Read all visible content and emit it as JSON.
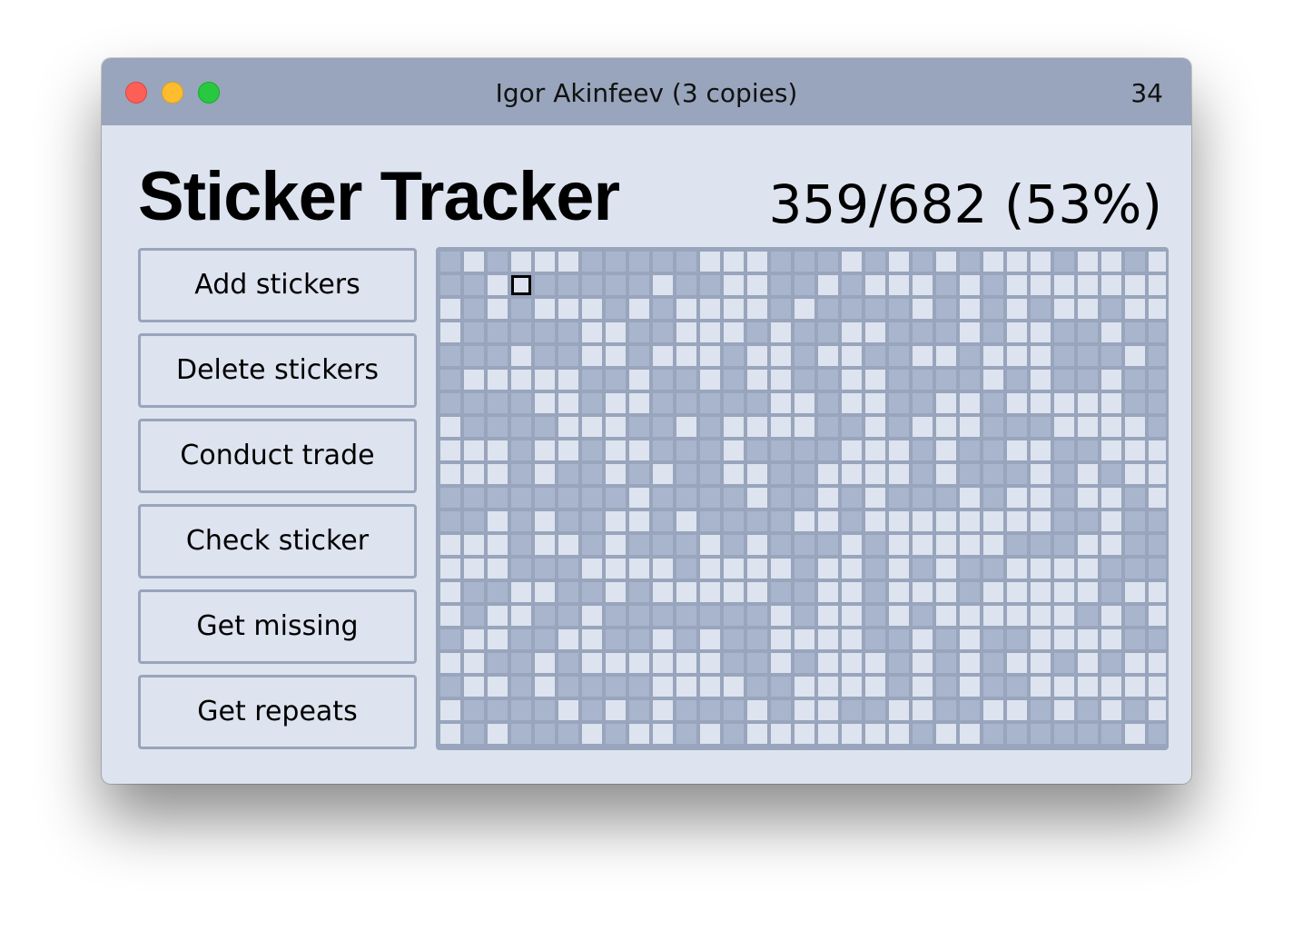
{
  "window": {
    "title": "Igor Akinfeev (3 copies)",
    "count": "34",
    "controls": [
      "close",
      "minimize",
      "zoom"
    ]
  },
  "app": {
    "title": "Sticker Tracker",
    "progress": "359/682 (53%)"
  },
  "actions": [
    {
      "label": "Add stickers"
    },
    {
      "label": "Delete stickers"
    },
    {
      "label": "Conduct trade"
    },
    {
      "label": "Check sticker"
    },
    {
      "label": "Get missing"
    },
    {
      "label": "Get repeats"
    }
  ],
  "sticker_grid": {
    "columns": 31,
    "rows": 22,
    "total": 682,
    "collected": 359,
    "selected_index": 34,
    "colors": {
      "collected": "#dde3ef",
      "missing": "#a9b5cc",
      "grid_line": "#98a5bc",
      "selected_border": "#000000"
    }
  }
}
